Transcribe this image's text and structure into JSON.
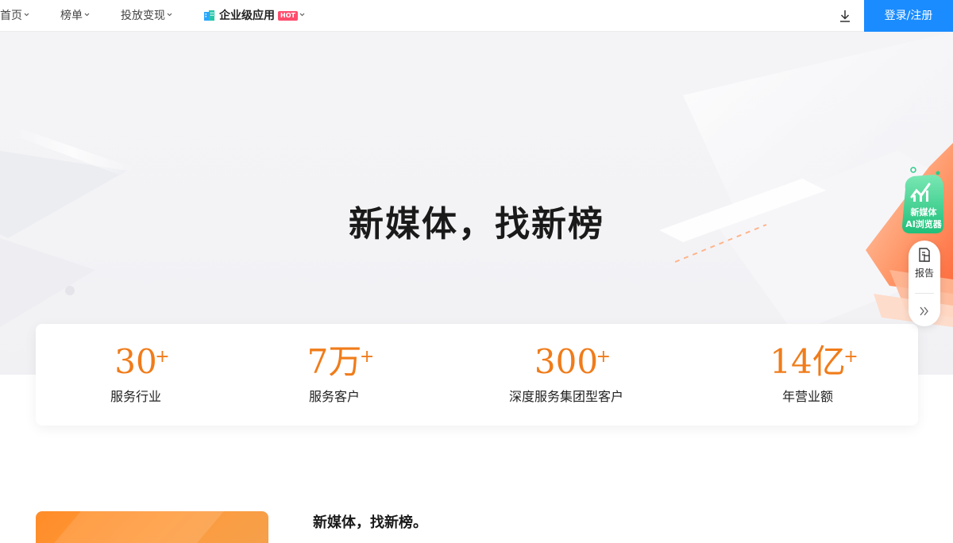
{
  "nav": {
    "items": [
      {
        "label": "首页"
      },
      {
        "label": "榜单"
      },
      {
        "label": "投放变现"
      }
    ],
    "enterprise": {
      "label": "企业级应用",
      "badge": "HOT",
      "icon": "building-icon"
    },
    "download_icon": "download-icon",
    "login_label": "登录/注册"
  },
  "hero": {
    "title": "新媒体，找新榜"
  },
  "stats": [
    {
      "value": "30",
      "suffix": "+",
      "label": "服务行业"
    },
    {
      "value": "7万",
      "suffix": "+",
      "label": "服务客户"
    },
    {
      "value": "300",
      "suffix": "+",
      "label": "深度服务集团型客户"
    },
    {
      "value": "14亿",
      "suffix": "+",
      "label": "年营业额"
    }
  ],
  "side_tools": {
    "ai_widget": {
      "line1": "新媒体",
      "line2": "AI浏览器"
    },
    "report_label": "报告",
    "collapse_icon": "double-chevron-right-icon"
  },
  "section": {
    "title": "新媒体，找新榜。"
  },
  "colors": {
    "accent": "#1a8cff",
    "stat_orange": "#f07c1a",
    "hot_badge": "#ff4d6d",
    "ai_green": "#2ecb8a"
  }
}
